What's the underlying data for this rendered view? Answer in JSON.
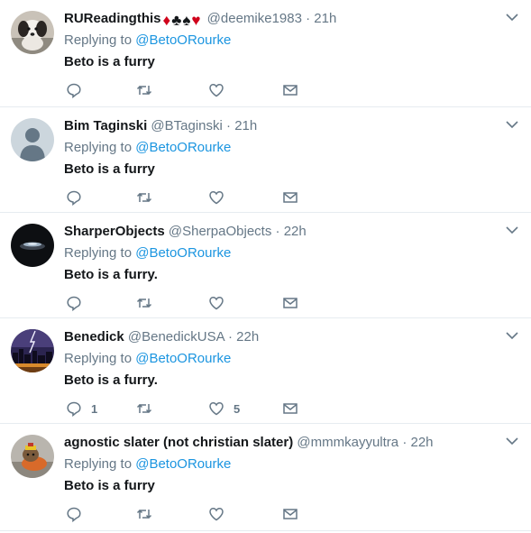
{
  "tweets": [
    {
      "name": "RUReadingthis",
      "handle": "@deemike1983",
      "time": "21h",
      "replying_prefix": "Replying to",
      "mention": "@BetoORourke",
      "text": "Beto is a furry",
      "avatar_icon": "dog-photo-avatar",
      "name_suffix": [
        "♦",
        "♣",
        "♠",
        "♥"
      ],
      "reply_count": "",
      "like_count": ""
    },
    {
      "name": "Bim Taginski",
      "handle": "@BTaginski",
      "time": "21h",
      "replying_prefix": "Replying to",
      "mention": "@BetoORourke",
      "text": "Beto is a furry",
      "avatar_icon": "default-profile-avatar",
      "reply_count": "",
      "like_count": ""
    },
    {
      "name": "SharperObjects",
      "handle": "@SherpaObjects",
      "time": "22h",
      "replying_prefix": "Replying to",
      "mention": "@BetoORourke",
      "text": "Beto is a furry.",
      "avatar_icon": "dark-object-avatar",
      "reply_count": "",
      "like_count": ""
    },
    {
      "name": "Benedick",
      "handle": "@BenedickUSA",
      "time": "22h",
      "replying_prefix": "Replying to",
      "mention": "@BetoORourke",
      "text": "Beto is a furry.",
      "avatar_icon": "city-lightning-avatar",
      "reply_count": "1",
      "like_count": "5"
    },
    {
      "name": "agnostic slater (not christian slater)",
      "handle": "@mmmkayyultra",
      "time": "22h",
      "replying_prefix": "Replying to",
      "mention": "@BetoORourke",
      "text": "Beto is a furry",
      "avatar_icon": "costumed-dog-avatar",
      "reply_count": "",
      "like_count": ""
    }
  ],
  "colors": {
    "link": "#1b95e0",
    "secondary": "#657786",
    "suit_red": "#d0021b",
    "suit_black": "#14171a"
  },
  "icons": {
    "reply": "reply-icon",
    "retweet": "retweet-icon",
    "like": "heart-icon",
    "dm": "envelope-icon",
    "more": "chevron-down-icon"
  }
}
